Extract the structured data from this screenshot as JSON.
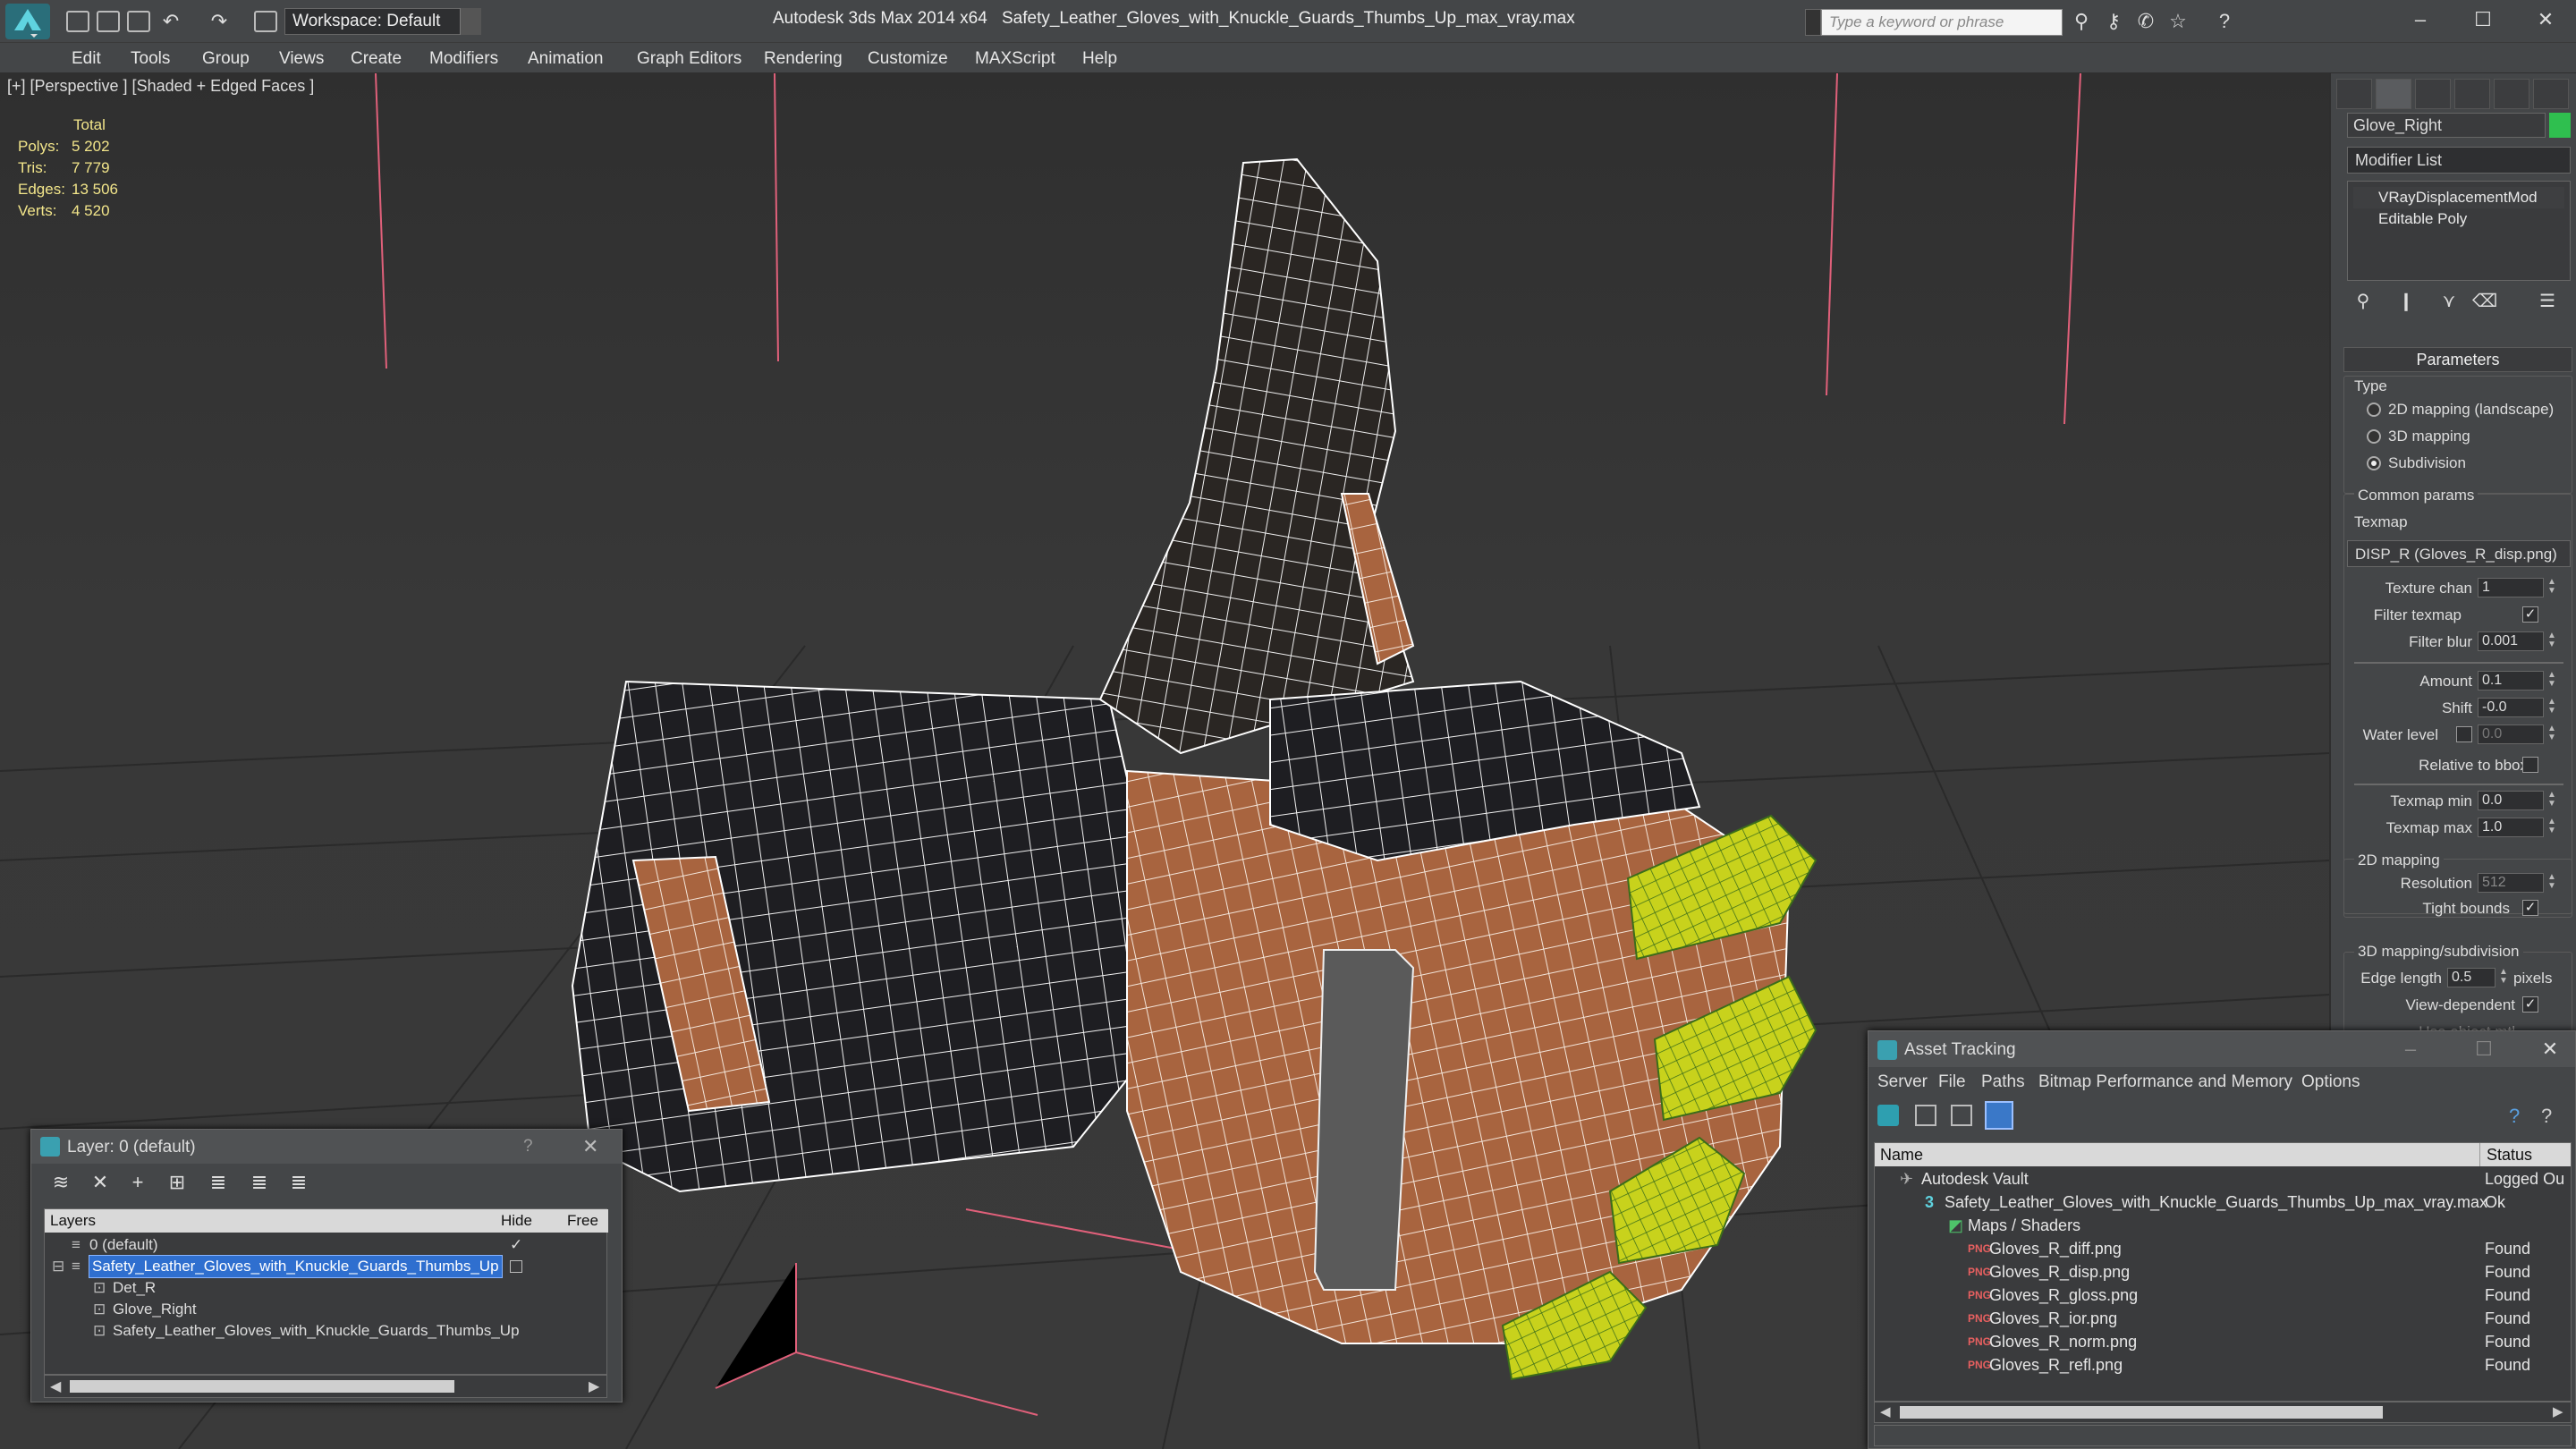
{
  "titlebar": {
    "workspace": "Workspace: Default",
    "app_title": "Autodesk 3ds Max  2014 x64",
    "file_title": "Safety_Leather_Gloves_with_Knuckle_Guards_Thumbs_Up_max_vray.max",
    "search_placeholder": "Type a keyword or phrase"
  },
  "menubar": {
    "items": [
      "Edit",
      "Tools",
      "Group",
      "Views",
      "Create",
      "Modifiers",
      "Animation",
      "Graph Editors",
      "Rendering",
      "Customize",
      "MAXScript",
      "Help"
    ]
  },
  "viewport": {
    "label": "[+] [Perspective ] [Shaded + Edged Faces ]",
    "stats": {
      "total_label": "Total",
      "rows": [
        {
          "label": "Polys:",
          "value": "5 202"
        },
        {
          "label": "Tris:",
          "value": "7 779"
        },
        {
          "label": "Edges:",
          "value": "13 506"
        },
        {
          "label": "Verts:",
          "value": "4 520"
        }
      ]
    }
  },
  "command_panel": {
    "object_name": "Glove_Right",
    "object_color": "#2fbf4f",
    "modifier_list": "Modifier List",
    "stack": [
      "VRayDisplacementMod",
      "Editable Poly"
    ],
    "parameters_title": "Parameters",
    "type_group": {
      "label": "Type",
      "options": [
        "2D mapping (landscape)",
        "3D mapping",
        "Subdivision"
      ],
      "selected": "Subdivision"
    },
    "common_params": {
      "label": "Common params",
      "texmap_label": "Texmap",
      "texmap_value": "DISP_R (Gloves_R_disp.png)",
      "texture_chan_label": "Texture chan",
      "texture_chan_value": "1",
      "filter_texmap_label": "Filter texmap",
      "filter_blur_label": "Filter blur",
      "filter_blur_value": "0.001",
      "amount_label": "Amount",
      "amount_value": "0.1",
      "shift_label": "Shift",
      "shift_value": "-0.0",
      "water_level_label": "Water level",
      "water_level_value": "0.0",
      "relative_bbox_label": "Relative to bbox",
      "texmap_min_label": "Texmap min",
      "texmap_min_value": "0.0",
      "texmap_max_label": "Texmap max",
      "texmap_max_value": "1.0"
    },
    "mapping_2d": {
      "label": "2D mapping",
      "resolution_label": "Resolution",
      "resolution_value": "512",
      "tight_bounds_label": "Tight bounds"
    },
    "mapping_3d": {
      "label": "3D mapping/subdivision",
      "edge_length_label": "Edge length",
      "edge_length_value": "0.5",
      "pixels_label": "pixels",
      "view_dependent_label": "View-dependent",
      "use_object_mtl_label": "Use object mtl"
    }
  },
  "layer_window": {
    "title": "Layer: 0 (default)",
    "help": "?",
    "columns": [
      "Layers",
      "Hide",
      "Free"
    ],
    "rows": [
      {
        "name": "0 (default)",
        "indent": 0,
        "type": "layer"
      },
      {
        "name": "Safety_Leather_Gloves_with_Knuckle_Guards_Thumbs_Up",
        "indent": 0,
        "type": "layer",
        "selected": true
      },
      {
        "name": "Det_R",
        "indent": 1,
        "type": "object"
      },
      {
        "name": "Glove_Right",
        "indent": 1,
        "type": "object"
      },
      {
        "name": "Safety_Leather_Gloves_with_Knuckle_Guards_Thumbs_Up",
        "indent": 1,
        "type": "object"
      }
    ]
  },
  "asset_tracking": {
    "title": "Asset Tracking",
    "menu": [
      "Server",
      "File",
      "Paths",
      "Bitmap Performance and Memory",
      "Options"
    ],
    "columns": [
      "Name",
      "Status"
    ],
    "rows": [
      {
        "name": "Autodesk Vault",
        "status": "Logged Ou",
        "indent": 0
      },
      {
        "name": "Safety_Leather_Gloves_with_Knuckle_Guards_Thumbs_Up_max_vray.max",
        "status": "Ok",
        "indent": 1
      },
      {
        "name": "Maps / Shaders",
        "status": "",
        "indent": 2
      },
      {
        "name": "Gloves_R_diff.png",
        "status": "Found",
        "indent": 3
      },
      {
        "name": "Gloves_R_disp.png",
        "status": "Found",
        "indent": 3
      },
      {
        "name": "Gloves_R_gloss.png",
        "status": "Found",
        "indent": 3
      },
      {
        "name": "Gloves_R_ior.png",
        "status": "Found",
        "indent": 3
      },
      {
        "name": "Gloves_R_norm.png",
        "status": "Found",
        "indent": 3
      },
      {
        "name": "Gloves_R_refl.png",
        "status": "Found",
        "indent": 3
      }
    ]
  },
  "colors": {
    "leather_dark": "#1e1e22",
    "leather_tan": "#a8643f",
    "knuckle_yellow": "#c8d21c",
    "selection_blue": "#2f6fcf",
    "stats_yellow": "#f2e58a"
  }
}
